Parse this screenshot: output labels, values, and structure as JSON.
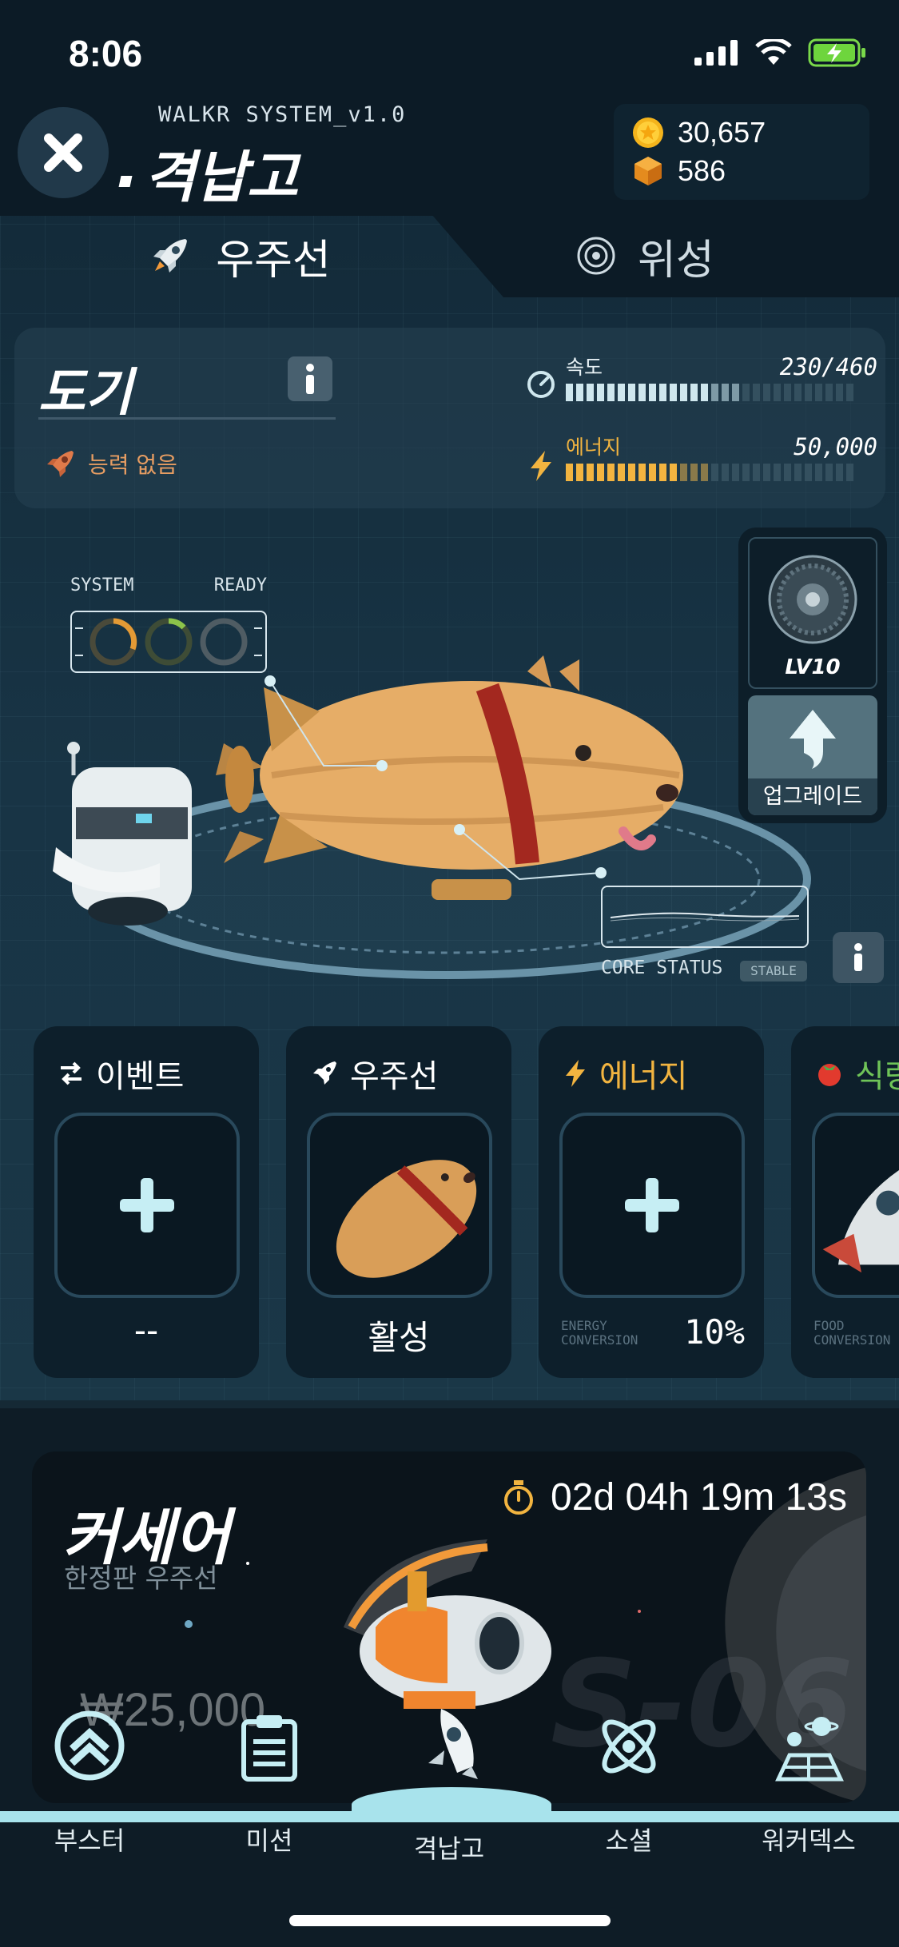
{
  "status_bar": {
    "time": "8:06"
  },
  "header": {
    "system_label": "WALKR SYSTEM_v1.0",
    "title": "격납고",
    "wallet": {
      "coins": "30,657",
      "cubes": "586"
    }
  },
  "tabs": [
    {
      "label": "우주선",
      "icon": "rocket-icon",
      "active": true
    },
    {
      "label": "위성",
      "icon": "satellite-orbit-icon",
      "active": false
    }
  ],
  "ship": {
    "name": "도기",
    "ability": "능력 없음",
    "speed": {
      "label": "속도",
      "value": "230/460",
      "fill": 0.5
    },
    "energy": {
      "label": "에너지",
      "value": "50,000",
      "fill": 0.4
    }
  },
  "scene": {
    "system_label": "SYSTEM",
    "ready_label": "READY",
    "level": "LV10",
    "upgrade_label": "업그레이드",
    "core_status_label": "CORE STATUS",
    "core_status_badge": "STABLE"
  },
  "slots": [
    {
      "title": "이벤트",
      "icon": "event-swap-icon",
      "footer": "--"
    },
    {
      "title": "우주선",
      "icon": "rocket-icon",
      "footer": "활성"
    },
    {
      "title": "에너지",
      "icon": "lightning-icon",
      "conversion_label": "ENERGY\nCONVERSION",
      "conversion_value": "10%"
    },
    {
      "title": "식량",
      "icon": "tomato-icon",
      "conversion_label": "FOOD\nCONVERSION"
    }
  ],
  "promo": {
    "title": "커세어",
    "subtitle": "한정판 우주선",
    "timer": "02d 04h 19m 13s",
    "price": "₩25,000",
    "watermark": "S-06"
  },
  "nav": [
    {
      "label": "부스터",
      "icon": "booster-chevrons-icon"
    },
    {
      "label": "미션",
      "icon": "clipboard-icon"
    },
    {
      "label": "격납고",
      "icon": "rocket-icon",
      "active": true
    },
    {
      "label": "소셜",
      "icon": "atom-icon"
    },
    {
      "label": "워커덱스",
      "icon": "walkerdex-icon"
    }
  ],
  "colors": {
    "accent_energy": "#f2b440",
    "accent_speed": "#cfe7ee",
    "ability": "#e79d62"
  }
}
